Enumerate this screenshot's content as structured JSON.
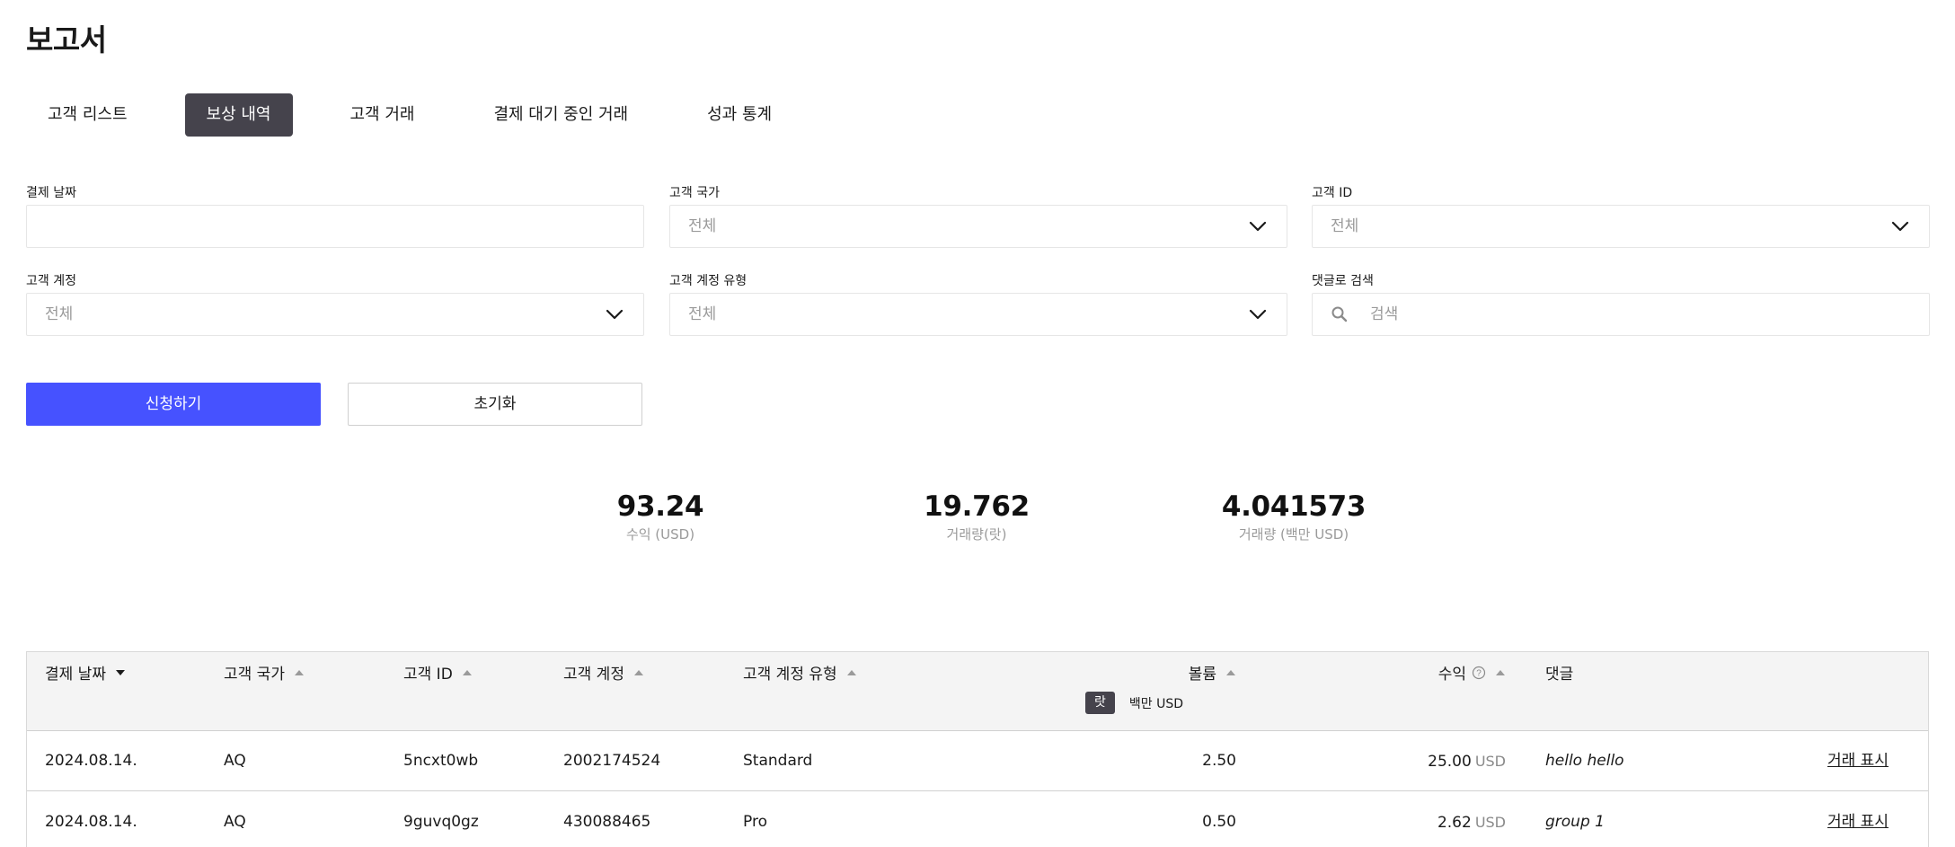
{
  "page": {
    "title": "보고서"
  },
  "tabs": [
    {
      "label": "고객 리스트",
      "active": false
    },
    {
      "label": "보상 내역",
      "active": true
    },
    {
      "label": "고객 거래",
      "active": false
    },
    {
      "label": "결제 대기 중인 거래",
      "active": false
    },
    {
      "label": "성과 통계",
      "active": false
    }
  ],
  "filters": {
    "settlement_date": {
      "label": "결제 날짜",
      "value": ""
    },
    "client_country": {
      "label": "고객 국가",
      "value": "전체"
    },
    "client_id": {
      "label": "고객 ID",
      "value": "전체"
    },
    "client_account": {
      "label": "고객 계정",
      "value": "전체"
    },
    "client_account_type": {
      "label": "고객 계정 유형",
      "value": "전체"
    },
    "comment_search": {
      "label": "댓글로 검색",
      "placeholder": "검색"
    }
  },
  "buttons": {
    "apply": "신청하기",
    "reset": "초기화"
  },
  "stats": [
    {
      "value": "93.24",
      "label": "수익 (USD)"
    },
    {
      "value": "19.762",
      "label": "거래량(랏)"
    },
    {
      "value": "4.041573",
      "label": "거래량 (백만 USD)"
    }
  ],
  "table": {
    "columns": {
      "date": "결제 날짜",
      "country": "고객 국가",
      "id": "고객 ID",
      "account": "고객 계정",
      "account_type": "고객 계정 유형",
      "volume": "볼륨",
      "revenue": "수익",
      "comment": "댓글"
    },
    "unit_toggle": {
      "lot": "랏",
      "usd": "백만 USD",
      "selected": "lot"
    },
    "rows": [
      {
        "date": "2024.08.14.",
        "country": "AQ",
        "id": "5ncxt0wb",
        "account": "2002174524",
        "account_type": "Standard",
        "volume": "2.50",
        "revenue": "25.00",
        "currency": "USD",
        "comment": "hello hello",
        "action": "거래 표시"
      },
      {
        "date": "2024.08.14.",
        "country": "AQ",
        "id": "9guvq0gz",
        "account": "430088465",
        "account_type": "Pro",
        "volume": "0.50",
        "revenue": "2.62",
        "currency": "USD",
        "comment": "group 1",
        "action": "거래 표시"
      }
    ]
  },
  "icons": {
    "dropdown": "chevron-down-icon",
    "search": "search-icon",
    "sort": "sort-arrow-icon",
    "help": "question-circle-icon"
  }
}
